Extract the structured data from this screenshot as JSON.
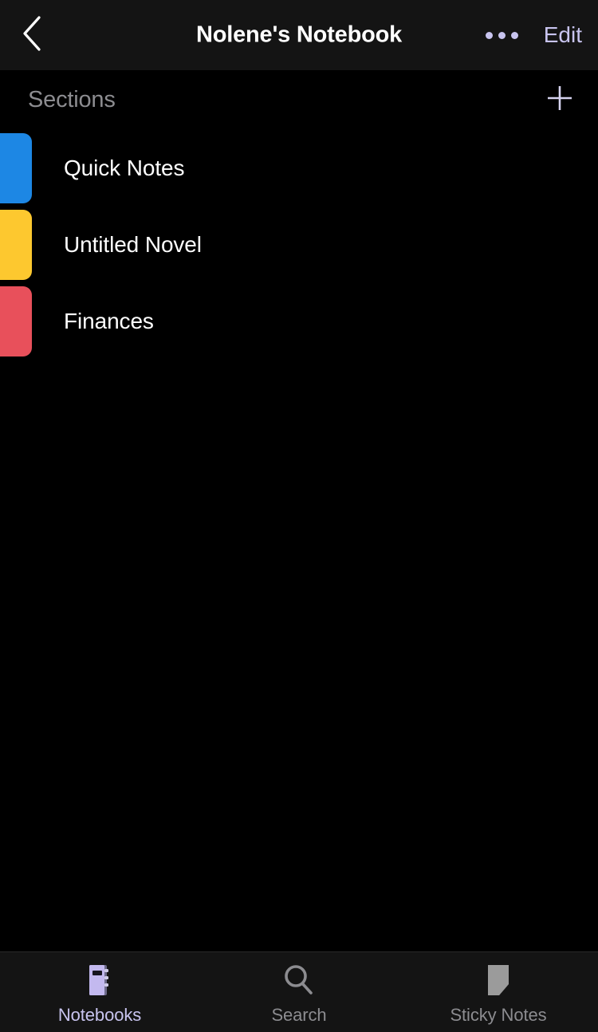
{
  "navbar": {
    "back_icon": "chevron-left-icon",
    "title": "Nolene's Notebook",
    "more_icon": "more-horizontal-icon",
    "edit_label": "Edit",
    "accent_color": "#c8c4ef",
    "background": "#141414"
  },
  "sections_header": {
    "title": "Sections",
    "title_color": "#8c8c90",
    "add_icon": "plus-icon"
  },
  "sections": [
    {
      "name": "Quick Notes",
      "color": "#1d87e4"
    },
    {
      "name": "Untitled Novel",
      "color": "#fdc82f"
    },
    {
      "name": "Finances",
      "color": "#e8505b"
    }
  ],
  "tabbar": {
    "background": "#141414",
    "active_color": "#c8c4ef",
    "inactive_color": "#8c8c90",
    "items": [
      {
        "label": "Notebooks",
        "icon": "notebook-icon",
        "active": true
      },
      {
        "label": "Search",
        "icon": "search-icon",
        "active": false
      },
      {
        "label": "Sticky Notes",
        "icon": "sticky-note-icon",
        "active": false
      }
    ]
  }
}
